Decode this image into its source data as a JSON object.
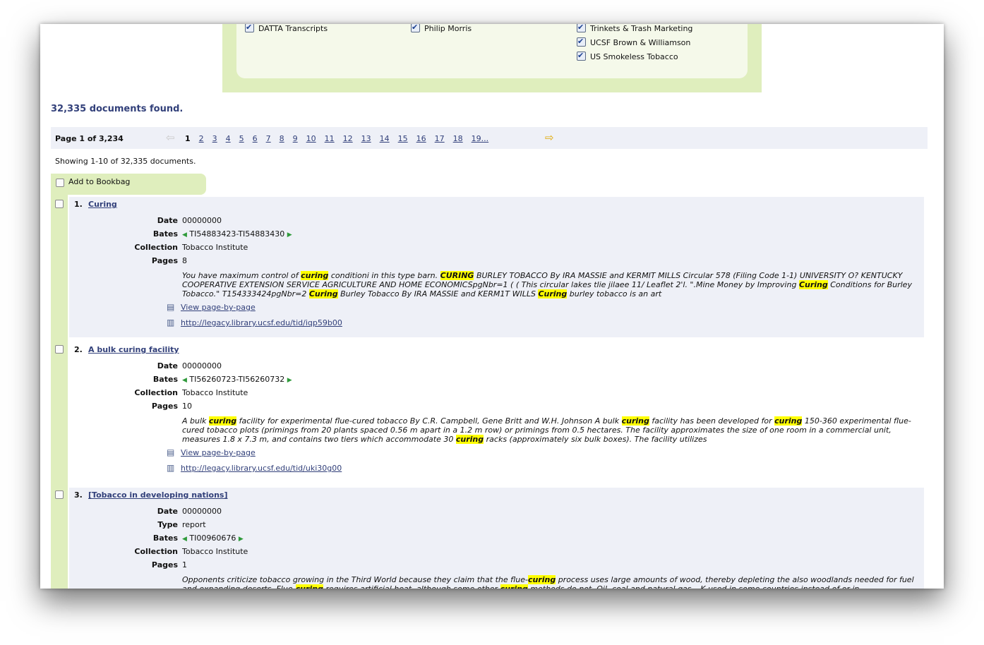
{
  "collections": [
    {
      "label": "DATTA Transcripts",
      "checked": true
    },
    {
      "label": "Philip Morris",
      "checked": true
    },
    {
      "label": "Trinkets & Trash Marketing",
      "checked": true
    },
    {
      "label": "UCSF Brown & Williamson",
      "checked": true
    },
    {
      "label": "US Smokeless Tobacco",
      "checked": true
    }
  ],
  "results_summary": "32,335 documents found.",
  "pager": {
    "info": "Page 1 of 3,234",
    "prev_icon": "prev-arrow-icon",
    "next_icon": "next-arrow-icon",
    "pages": [
      "1",
      "2",
      "3",
      "4",
      "5",
      "6",
      "7",
      "8",
      "9",
      "10",
      "11",
      "12",
      "13",
      "14",
      "15",
      "16",
      "17",
      "18",
      "19..."
    ],
    "current": "1"
  },
  "showing": "Showing 1-10 of 32,335 documents.",
  "bookbag_label": "Add to Bookbag",
  "labels": {
    "date": "Date",
    "type": "Type",
    "bates": "Bates",
    "collection": "Collection",
    "pages": "Pages",
    "view_page": "View page-by-page"
  },
  "results": [
    {
      "num": "1.",
      "title": "Curing",
      "date": "00000000",
      "bates": "TI54883423-TI54883430",
      "collection": "Tobacco Institute",
      "pages": "8",
      "link": "http://legacy.library.ucsf.edu/tid/iqp59b00"
    },
    {
      "num": "2.",
      "title": "A bulk curing facility",
      "date": "00000000",
      "bates": "TI56260723-TI56260732",
      "collection": "Tobacco Institute",
      "pages": "10",
      "link": "http://legacy.library.ucsf.edu/tid/uki30g00"
    },
    {
      "num": "3.",
      "title": "[Tobacco in developing nations]",
      "date": "00000000",
      "type": "report",
      "bates": "TI00960676",
      "collection": "Tobacco Institute",
      "pages": "1"
    }
  ],
  "snippets": {
    "r1": [
      {
        "t": "You have maximum control of "
      },
      {
        "t": "curing",
        "hl": true
      },
      {
        "t": " conditioni in this type barn. "
      },
      {
        "t": "CURING",
        "hl": true
      },
      {
        "t": " BURLEY TOBACCO By IRA MASSIE and KERMIT MILLS Circular 578 (Filing Code 1-1) UNIVERSITY O? KENTUCKY COOPERATIVE EXTENSION SERVICE AGRICULTURE AND HOME ECONOMICSpgNbr=1 ( ( This circular lakes tlie jilaee 11/ Leaflet 2'l. \".Mine Money by Improving "
      },
      {
        "t": "Curing",
        "hl": true
      },
      {
        "t": " Conditions for Burley Tobacco.\" T154333424pgNbr=2 "
      },
      {
        "t": "Curing",
        "hl": true
      },
      {
        "t": " Burley Tobacco By IRA MASSIE and KERM1T WILLS "
      },
      {
        "t": "Curing",
        "hl": true
      },
      {
        "t": " burley tobacco is an art"
      }
    ],
    "r2": [
      {
        "t": "A bulk "
      },
      {
        "t": "curing",
        "hl": true
      },
      {
        "t": " facility for experimental flue-cured tobacco By C.R. Campbell, Gene Britt and W.H. Johnson A bulk "
      },
      {
        "t": "curing",
        "hl": true
      },
      {
        "t": " facility has been developed for "
      },
      {
        "t": "curing",
        "hl": true
      },
      {
        "t": " 150-360 experimental flue-cured tobacco plots (primings from 20 plants spaced 0.56 m apart in a 1.2 m row) or primings from 0.5 hectares. The facility approximates the size of one room in a commercial unit, measures 1.8 x 7.3 m, and contains two tiers which accommodate 30 "
      },
      {
        "t": "curing",
        "hl": true
      },
      {
        "t": " racks (approximately six bulk boxes). The facility utilizes"
      }
    ],
    "r3": [
      {
        "t": "Opponents criticize tobacco growing in the Third World because they claim that the flue-"
      },
      {
        "t": "curing",
        "hl": true
      },
      {
        "t": " process uses large amounts of wood, thereby depleting the also woodlands needed for fuel and expanding deserts. Flue-"
      },
      {
        "t": "curing",
        "hl": true
      },
      {
        "t": " requires artificial heat, although some other "
      },
      {
        "t": "curing",
        "hl": true
      },
      {
        "t": " methods do not. Oil, coal and natural gas ~K used in some countries instead of or in"
      }
    ]
  }
}
